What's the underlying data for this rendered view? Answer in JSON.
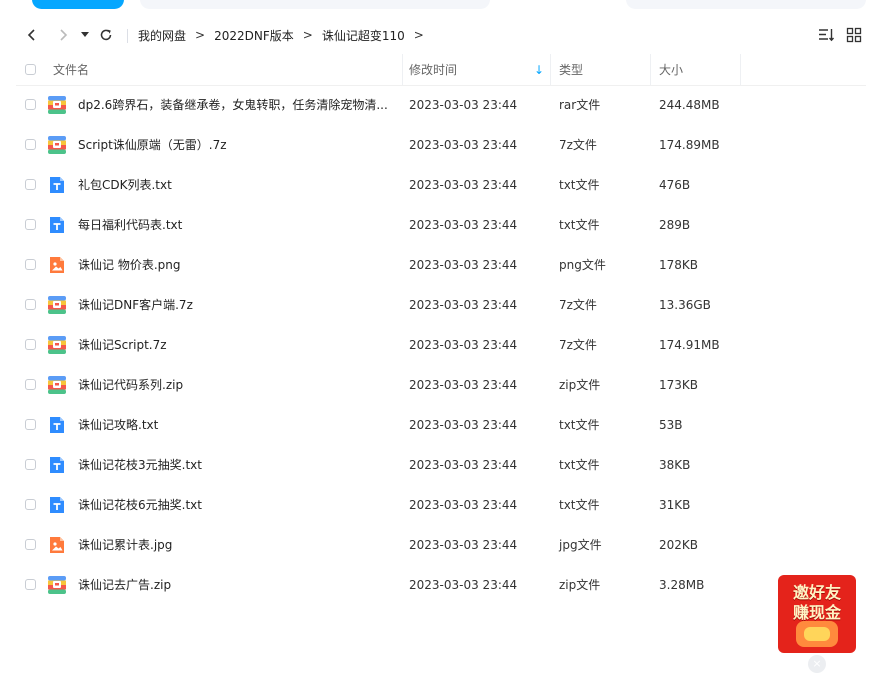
{
  "breadcrumb": [
    "我的网盘",
    "2022DNF版本",
    "诛仙记超变110"
  ],
  "breadcrumb_separator": ">",
  "columns": {
    "name": "文件名",
    "modified": "修改时间",
    "type": "类型",
    "size": "大小"
  },
  "sort_indicator": "↓",
  "files": [
    {
      "icon": "archive-file-icon",
      "name": "dp2.6跨界石，装备继承卷，女鬼转职，任务清除宠物清...",
      "modified": "2023-03-03 23:44",
      "type": "rar文件",
      "size": "244.48MB"
    },
    {
      "icon": "archive-file-icon",
      "name": "Script诛仙原端（无雷）.7z",
      "modified": "2023-03-03 23:44",
      "type": "7z文件",
      "size": "174.89MB"
    },
    {
      "icon": "text-file-icon",
      "name": "礼包CDK列表.txt",
      "modified": "2023-03-03 23:44",
      "type": "txt文件",
      "size": "476B"
    },
    {
      "icon": "text-file-icon",
      "name": "每日福利代码表.txt",
      "modified": "2023-03-03 23:44",
      "type": "txt文件",
      "size": "289B"
    },
    {
      "icon": "image-file-icon",
      "name": "诛仙记  物价表.png",
      "modified": "2023-03-03 23:44",
      "type": "png文件",
      "size": "178KB"
    },
    {
      "icon": "archive-file-icon",
      "name": "诛仙记DNF客户端.7z",
      "modified": "2023-03-03 23:44",
      "type": "7z文件",
      "size": "13.36GB"
    },
    {
      "icon": "archive-file-icon",
      "name": "诛仙记Script.7z",
      "modified": "2023-03-03 23:44",
      "type": "7z文件",
      "size": "174.91MB"
    },
    {
      "icon": "archive-file-icon",
      "name": "诛仙记代码系列.zip",
      "modified": "2023-03-03 23:44",
      "type": "zip文件",
      "size": "173KB"
    },
    {
      "icon": "text-file-icon",
      "name": "诛仙记攻略.txt",
      "modified": "2023-03-03 23:44",
      "type": "txt文件",
      "size": "53B"
    },
    {
      "icon": "text-file-icon",
      "name": "诛仙记花枝3元抽奖.txt",
      "modified": "2023-03-03 23:44",
      "type": "txt文件",
      "size": "38KB"
    },
    {
      "icon": "text-file-icon",
      "name": "诛仙记花枝6元抽奖.txt",
      "modified": "2023-03-03 23:44",
      "type": "txt文件",
      "size": "31KB"
    },
    {
      "icon": "image-file-icon",
      "name": "诛仙记累计表.jpg",
      "modified": "2023-03-03 23:44",
      "type": "jpg文件",
      "size": "202KB"
    },
    {
      "icon": "archive-file-icon",
      "name": "诛仙记去广告.zip",
      "modified": "2023-03-03 23:44",
      "type": "zip文件",
      "size": "3.28MB"
    }
  ],
  "promo": {
    "line1": "邀好友",
    "line2": "赚现金",
    "close_label": "×"
  },
  "colors": {
    "accent": "#06a7ff",
    "text_icon": "#2f8cff",
    "image_icon": "#ff7a3c",
    "promo": "#e4231b"
  }
}
